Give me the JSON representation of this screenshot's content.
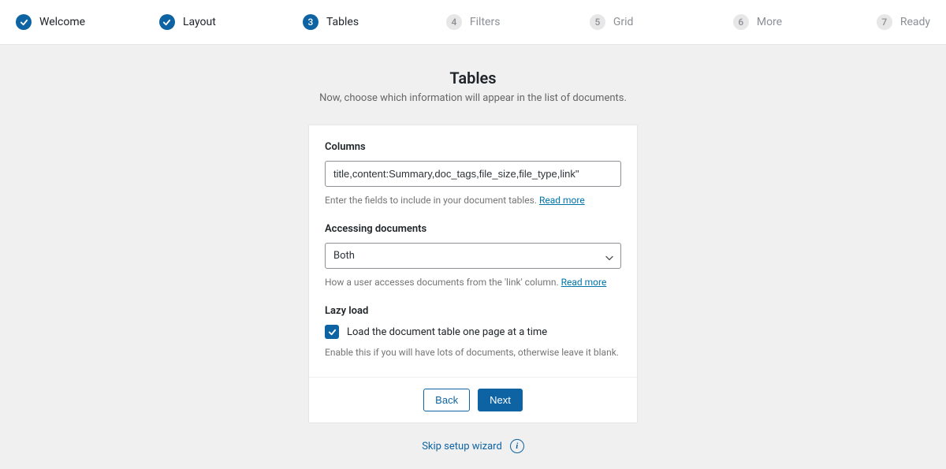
{
  "stepper": {
    "steps": [
      {
        "label": "Welcome",
        "state": "done"
      },
      {
        "label": "Layout",
        "state": "done"
      },
      {
        "label": "Tables",
        "state": "active",
        "number": "3"
      },
      {
        "label": "Filters",
        "state": "pending",
        "number": "4"
      },
      {
        "label": "Grid",
        "state": "pending",
        "number": "5"
      },
      {
        "label": "More",
        "state": "pending",
        "number": "6"
      },
      {
        "label": "Ready",
        "state": "pending",
        "number": "7"
      }
    ]
  },
  "header": {
    "title": "Tables",
    "subtitle": "Now, choose which information will appear in the list of documents."
  },
  "fields": {
    "columns": {
      "label": "Columns",
      "value": "title,content:Summary,doc_tags,file_size,file_type,link\"",
      "help_text": "Enter the fields to include in your document tables. ",
      "help_link": "Read more"
    },
    "accessing": {
      "label": "Accessing documents",
      "value": "Both",
      "help_text": "How a user accesses documents from the 'link' column. ",
      "help_link": "Read more"
    },
    "lazy": {
      "label": "Lazy load",
      "checkbox_label": "Load the document table one page at a time",
      "checked": true,
      "help_text": "Enable this if you will have lots of documents, otherwise leave it blank."
    }
  },
  "buttons": {
    "back": "Back",
    "next": "Next"
  },
  "footer": {
    "skip": "Skip setup wizard"
  }
}
